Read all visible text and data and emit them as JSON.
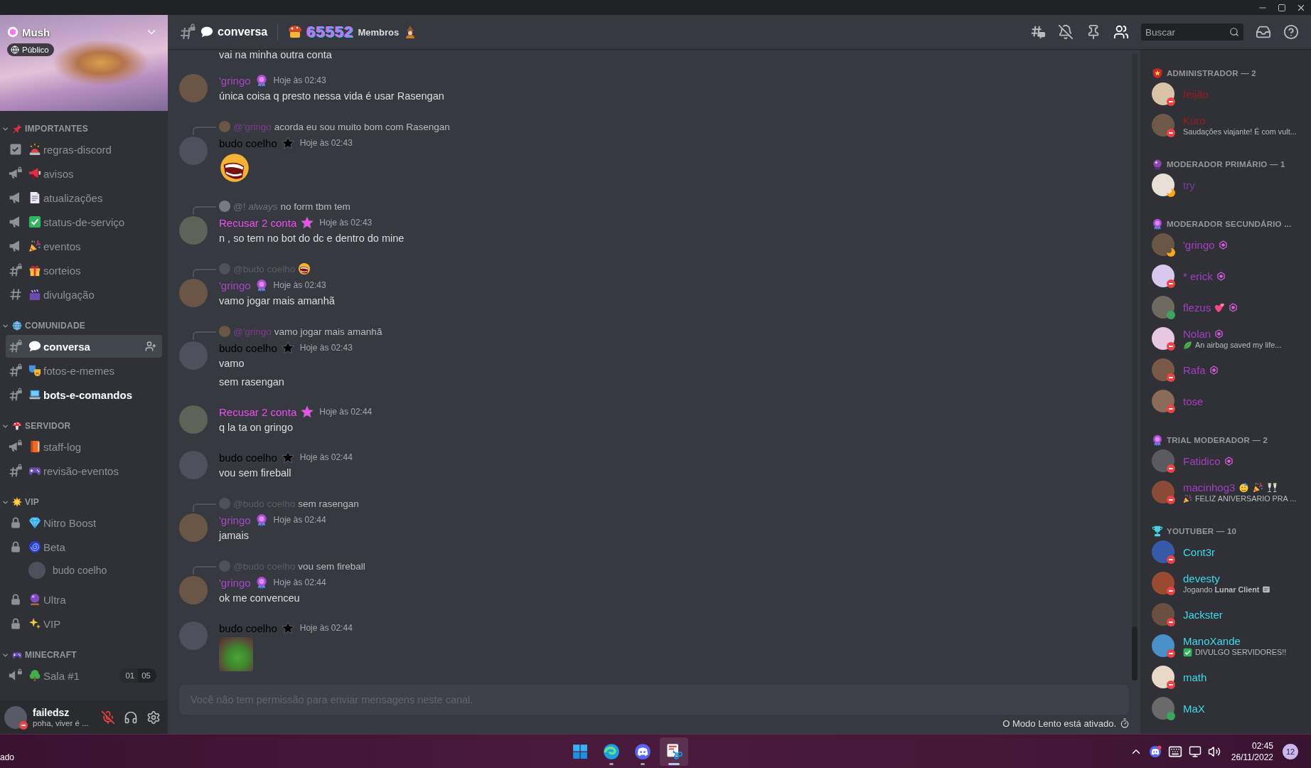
{
  "server": {
    "name": "Mush",
    "visibility": "Público"
  },
  "categories": [
    {
      "name": "IMPORTANTES",
      "expanded": true,
      "channels": [
        {
          "name": "regras-discord",
          "kind": "rules",
          "selected": false,
          "unread": false
        },
        {
          "name": "avisos",
          "kind": "announcement-locked",
          "selected": false,
          "unread": false
        },
        {
          "name": "atualizações",
          "kind": "announcement",
          "selected": false,
          "unread": false
        },
        {
          "name": "status-de-serviço",
          "kind": "announcement",
          "selected": false,
          "unread": false
        },
        {
          "name": "eventos",
          "kind": "announcement",
          "selected": false,
          "unread": false
        },
        {
          "name": "sorteios",
          "kind": "text-locked",
          "selected": false,
          "unread": false
        },
        {
          "name": "divulgação",
          "kind": "text",
          "selected": false,
          "unread": false
        }
      ]
    },
    {
      "name": "COMUNIDADE",
      "expanded": true,
      "channels": [
        {
          "name": "conversa",
          "kind": "text-locked",
          "selected": true,
          "unread": false
        },
        {
          "name": "fotos-e-memes",
          "kind": "text-locked",
          "selected": false,
          "unread": false
        },
        {
          "name": "bots-e-comandos",
          "kind": "text-locked",
          "selected": false,
          "unread": true
        }
      ]
    },
    {
      "name": "SERVIDOR",
      "expanded": true,
      "channels": [
        {
          "name": "staff-log",
          "kind": "announcement-locked",
          "selected": false,
          "unread": false
        },
        {
          "name": "revisão-eventos",
          "kind": "text-locked",
          "selected": false,
          "unread": false
        }
      ]
    },
    {
      "name": "VIP",
      "expanded": true,
      "channels": [
        {
          "name": "Nitro Boost",
          "kind": "voice-private",
          "selected": false,
          "unread": false
        },
        {
          "name": "Beta",
          "kind": "voice-private",
          "selected": false,
          "unread": false,
          "users": [
            {
              "name": "budo coelho"
            }
          ]
        },
        {
          "name": "Ultra",
          "kind": "voice-private",
          "selected": false,
          "unread": false
        },
        {
          "name": "VIP",
          "kind": "voice-private",
          "selected": false,
          "unread": false
        }
      ]
    },
    {
      "name": "MINECRAFT",
      "expanded": true,
      "channels": [
        {
          "name": "Sala #1",
          "kind": "voice-locked",
          "selected": false,
          "unread": false,
          "user_count": "01",
          "user_limit": "05"
        }
      ]
    }
  ],
  "user_panel": {
    "name": "failedsz",
    "status_text": "poha, viver é ...",
    "presence": {
      "kind": "dnd"
    },
    "muted": true
  },
  "header": {
    "channel": "conversa",
    "member_count": "65552",
    "member_label": "Membros",
    "search_placeholder": "Buscar",
    "member_list_open": true
  },
  "messages": [
    {
      "kind": "continuation",
      "lines": [
        "vai na minha outra conta"
      ]
    },
    {
      "kind": "text",
      "author": "'gringo",
      "color": "#a846c6",
      "time": "Hoje às 02:43",
      "lines": [
        "única coisa q presto nessa vida é usar Rasengan"
      ]
    },
    {
      "kind": "sticker",
      "author": "budo coelho",
      "color": "#000000",
      "time": "Hoje às 02:43",
      "reply": {
        "kind": "text",
        "mention": "@'gringo",
        "color": "#7c3b90",
        "text": "acorda eu sou muito bom com Rasengan"
      }
    },
    {
      "kind": "text",
      "author": "Recusar 2 conta",
      "color": "#f04ef0",
      "time": "Hoje às 02:43",
      "reply": {
        "kind": "text",
        "mention": "@! *always*",
        "color": "#6d7075",
        "text": "no form tbm tem"
      },
      "lines": [
        "n , so tem no bot do dc e dentro do mine"
      ]
    },
    {
      "kind": "text",
      "author": "'gringo",
      "color": "#a846c6",
      "time": "Hoje às 02:43",
      "reply": {
        "kind": "emoji",
        "mention": "@budo coelho",
        "color": "#5c5e63"
      },
      "lines": [
        "vamo jogar mais amanhã"
      ]
    },
    {
      "kind": "text",
      "author": "budo coelho",
      "color": "#000000",
      "time": "Hoje às 02:43",
      "reply": {
        "kind": "text",
        "mention": "@'gringo",
        "color": "#7c3b90",
        "text": "vamo jogar mais amanhã"
      },
      "lines": [
        "vamo",
        "sem rasengan"
      ]
    },
    {
      "kind": "text",
      "author": "Recusar 2 conta",
      "color": "#f04ef0",
      "time": "Hoje às 02:44",
      "lines": [
        "q la ta on gringo"
      ]
    },
    {
      "kind": "text",
      "author": "budo coelho",
      "color": "#000000",
      "time": "Hoje às 02:44",
      "lines": [
        "vou sem fireball"
      ]
    },
    {
      "kind": "text",
      "author": "'gringo",
      "color": "#a846c6",
      "time": "Hoje às 02:44",
      "reply": {
        "kind": "text",
        "mention": "@budo coelho",
        "color": "#5c5e63",
        "text": "sem rasengan"
      },
      "lines": [
        "jamais"
      ]
    },
    {
      "kind": "text",
      "author": "'gringo",
      "color": "#a846c6",
      "time": "Hoje às 02:44",
      "reply": {
        "kind": "text",
        "mention": "@budo coelho",
        "color": "#5c5e63",
        "text": "vou sem fireball"
      },
      "lines": [
        "ok me convenceu"
      ]
    },
    {
      "kind": "image",
      "author": "budo coelho",
      "color": "#000000",
      "time": "Hoje às 02:44"
    }
  ],
  "composer": {
    "placeholder": "Você não tem permissão para enviar mensagens neste canal."
  },
  "slow_mode": "O Modo Lento está ativado.",
  "member_groups": [
    {
      "title": "ADMINISTRADOR — 2",
      "members": [
        {
          "name": "feijão",
          "color": "#9b1c1c",
          "presence": {
            "kind": "dnd"
          },
          "booster": false
        },
        {
          "name": "Kuro",
          "color": "#9b1c1c",
          "presence": {
            "kind": "dnd"
          },
          "booster": false,
          "activity": "Saudações viajante! É com vult..."
        }
      ]
    },
    {
      "title": "MODERADOR PRIMÁRIO — 1",
      "members": [
        {
          "name": "try",
          "color": "#7e3aa2",
          "presence": {
            "kind": "idle"
          },
          "booster": false
        }
      ]
    },
    {
      "title": "MODERADOR SECUNDÁRIO ...",
      "members": [
        {
          "name": "'gringo",
          "color": "#a53dc4",
          "presence": {
            "kind": "idle"
          },
          "booster": true
        },
        {
          "name": "* erick",
          "color": "#a53dc4",
          "presence": {
            "kind": "dnd"
          },
          "booster": true
        },
        {
          "name": "flezus",
          "color": "#a53dc4",
          "presence": {
            "kind": "online"
          },
          "booster": true
        },
        {
          "name": "Nolan",
          "color": "#a53dc4",
          "presence": {
            "kind": "dnd"
          },
          "booster": true,
          "activity": "An airbag saved my life..."
        },
        {
          "name": "Rafa",
          "color": "#a53dc4",
          "presence": {
            "kind": "dnd"
          },
          "booster": true
        },
        {
          "name": "tose",
          "color": "#a53dc4",
          "presence": {
            "kind": "dnd"
          },
          "booster": false
        }
      ]
    },
    {
      "title": "TRIAL MODERADOR — 2",
      "members": [
        {
          "name": "Fatidico",
          "color": "#a53dc4",
          "presence": {
            "kind": "dnd"
          },
          "booster": true
        },
        {
          "name": "macinhog3",
          "color": "#a53dc4",
          "presence": {
            "kind": "dnd"
          },
          "booster": false,
          "activity": "FELIZ ANIVERSARIO PRA ..."
        }
      ]
    },
    {
      "title": "YOUTUBER — 10",
      "members": [
        {
          "name": "Cont3r",
          "color": "#40d8ef",
          "presence": {
            "kind": "dnd"
          },
          "booster": false
        },
        {
          "name": "devesty",
          "color": "#40d8ef",
          "presence": {
            "kind": "dnd"
          },
          "booster": false,
          "activity": "Jogando **Lunar Client**"
        },
        {
          "name": "Jackster",
          "color": "#40d8ef",
          "presence": {
            "kind": "dnd"
          },
          "booster": false
        },
        {
          "name": "ManoXande",
          "color": "#40d8ef",
          "presence": {
            "kind": "dnd"
          },
          "booster": false,
          "activity": "DIVULGO SERVIDORES!!"
        },
        {
          "name": "math",
          "color": "#40d8ef",
          "presence": {
            "kind": "dnd"
          },
          "booster": false
        },
        {
          "name": "MaX",
          "color": "#40d8ef",
          "presence": {
            "kind": "online"
          },
          "booster": false
        }
      ]
    }
  ],
  "taskbar": {
    "weather_text": "ado",
    "apps": [
      {
        "running": false,
        "selected": false
      },
      {
        "running": true,
        "selected": false
      },
      {
        "running": true,
        "selected": false
      },
      {
        "running": true,
        "selected": true
      }
    ],
    "time": "02:45",
    "date": "26/11/2022",
    "notifications": "12"
  }
}
